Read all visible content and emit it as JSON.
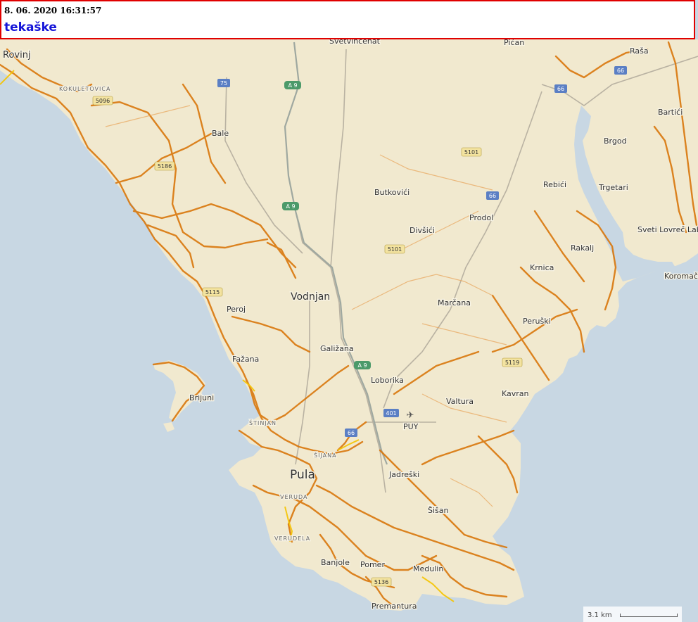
{
  "header": {
    "timestamp": "8. 06. 2020 16:31:57",
    "title": "tekaške",
    "border_color": "#e00000",
    "title_color": "#1414d8"
  },
  "map": {
    "colors": {
      "sea": "#c8d7e3",
      "land": "#f1e9cf",
      "track": "#d9770c",
      "track_light": "#e8a45a",
      "track_highlight": "#f5c400",
      "road_badge": "#f3e3a0",
      "highway_badge": "#4c9a6a",
      "national_badge": "#5b7fc4"
    },
    "places": [
      {
        "name": "Rovinj",
        "size": "m"
      },
      {
        "name": "Svetvinčenat",
        "size": "s"
      },
      {
        "name": "Pićan",
        "size": "s"
      },
      {
        "name": "Raša",
        "size": "s"
      },
      {
        "name": "KOKULETOVICA",
        "size": "xs"
      },
      {
        "name": "Bale",
        "size": "s"
      },
      {
        "name": "Bartići",
        "size": "s"
      },
      {
        "name": "Brgod",
        "size": "s"
      },
      {
        "name": "Rebići",
        "size": "s"
      },
      {
        "name": "Trgetari",
        "size": "s"
      },
      {
        "name": "Butkovići",
        "size": "s"
      },
      {
        "name": "Prodol",
        "size": "s"
      },
      {
        "name": "Divšići",
        "size": "s"
      },
      {
        "name": "Sveti Lovreč Labinski",
        "size": "s"
      },
      {
        "name": "Rakalj",
        "size": "s"
      },
      {
        "name": "Krnica",
        "size": "s"
      },
      {
        "name": "Koromačno",
        "size": "s"
      },
      {
        "name": "Vodnjan",
        "size": "l"
      },
      {
        "name": "Peroj",
        "size": "s"
      },
      {
        "name": "Marčana",
        "size": "s"
      },
      {
        "name": "Peruški",
        "size": "s"
      },
      {
        "name": "Galižana",
        "size": "s"
      },
      {
        "name": "Fažana",
        "size": "s"
      },
      {
        "name": "Loborika",
        "size": "s"
      },
      {
        "name": "Kavran",
        "size": "s"
      },
      {
        "name": "Valtura",
        "size": "s"
      },
      {
        "name": "Brijuni",
        "size": "s"
      },
      {
        "name": "ŠTINJAN",
        "size": "xs"
      },
      {
        "name": "PUY",
        "size": "s"
      },
      {
        "name": "ŠIJANA",
        "size": "xs"
      },
      {
        "name": "Pula",
        "size": "xl"
      },
      {
        "name": "Jadreški",
        "size": "s"
      },
      {
        "name": "VERUDA",
        "size": "xs"
      },
      {
        "name": "Šišan",
        "size": "s"
      },
      {
        "name": "VERUDELA",
        "size": "xs"
      },
      {
        "name": "Banjole",
        "size": "s"
      },
      {
        "name": "Pomer",
        "size": "s"
      },
      {
        "name": "Medulin",
        "size": "s"
      },
      {
        "name": "Premantura",
        "size": "s"
      }
    ],
    "road_badges": [
      {
        "label": "75",
        "kind": "national"
      },
      {
        "label": "A 9",
        "kind": "highway"
      },
      {
        "label": "66",
        "kind": "national"
      },
      {
        "label": "66",
        "kind": "national"
      },
      {
        "label": "5096",
        "kind": "regional"
      },
      {
        "label": "5101",
        "kind": "regional"
      },
      {
        "label": "5186",
        "kind": "regional"
      },
      {
        "label": "A 9",
        "kind": "highway"
      },
      {
        "label": "66",
        "kind": "national"
      },
      {
        "label": "5101",
        "kind": "regional"
      },
      {
        "label": "5115",
        "kind": "regional"
      },
      {
        "label": "A 9",
        "kind": "highway"
      },
      {
        "label": "5119",
        "kind": "regional"
      },
      {
        "label": "401",
        "kind": "national"
      },
      {
        "label": "66",
        "kind": "national"
      },
      {
        "label": "5136",
        "kind": "regional"
      }
    ],
    "airport_icon": "airplane-icon"
  },
  "scale": {
    "label": "3.1 km"
  }
}
